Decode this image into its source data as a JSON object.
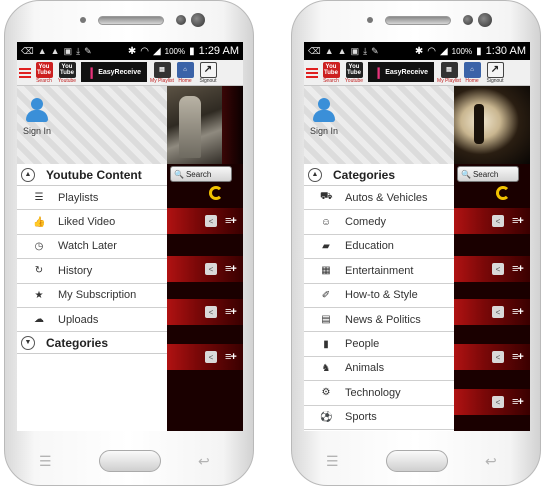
{
  "screens": [
    {
      "status": {
        "battery": "100%",
        "time": "1:29 AM"
      },
      "header": {
        "search_label": "Search",
        "youtube_label": "Youtube",
        "youtube_icon_text": "You Tube",
        "brand": "EasyReceive",
        "playlist_label": "My Playlist",
        "home_label": "Home",
        "signout_label": "Signout"
      },
      "signin": "Sign In",
      "section1": "Youtube Content",
      "items": [
        {
          "label": "Playlists",
          "icon": "playlist-icon"
        },
        {
          "label": "Liked Video",
          "icon": "thumbs-up-icon"
        },
        {
          "label": "Watch Later",
          "icon": "clock-icon"
        },
        {
          "label": "History",
          "icon": "history-icon"
        },
        {
          "label": "My Subscription",
          "icon": "star-icon"
        },
        {
          "label": "Uploads",
          "icon": "cloud-upload-icon"
        }
      ],
      "section2": "Categories",
      "search_button": "Search"
    },
    {
      "status": {
        "battery": "100%",
        "time": "1:30 AM"
      },
      "header": {
        "search_label": "Search",
        "youtube_label": "Youtube",
        "youtube_icon_text": "You Tube",
        "brand": "EasyReceive",
        "playlist_label": "My Playlist",
        "home_label": "Home",
        "signout_label": "Signout"
      },
      "signin": "Sign In",
      "section1": "Categories",
      "items": [
        {
          "label": "Autos & Vehicles",
          "icon": "truck-icon"
        },
        {
          "label": "Comedy",
          "icon": "masks-icon"
        },
        {
          "label": "Education",
          "icon": "graduation-cap-icon"
        },
        {
          "label": "Entertainment",
          "icon": "film-icon"
        },
        {
          "label": "How-to & Style",
          "icon": "brush-icon"
        },
        {
          "label": "News & Politics",
          "icon": "newspaper-icon"
        },
        {
          "label": "People",
          "icon": "person-icon"
        },
        {
          "label": "Animals",
          "icon": "dog-icon"
        },
        {
          "label": "Technology",
          "icon": "gears-icon"
        },
        {
          "label": "Sports",
          "icon": "soccer-ball-icon"
        }
      ],
      "search_button": "Search"
    }
  ],
  "colors": {
    "accent": "#e02020",
    "brand_pink": "#e8337b",
    "list_row_red": "#b01212",
    "refresh_yellow": "#f2c200"
  }
}
